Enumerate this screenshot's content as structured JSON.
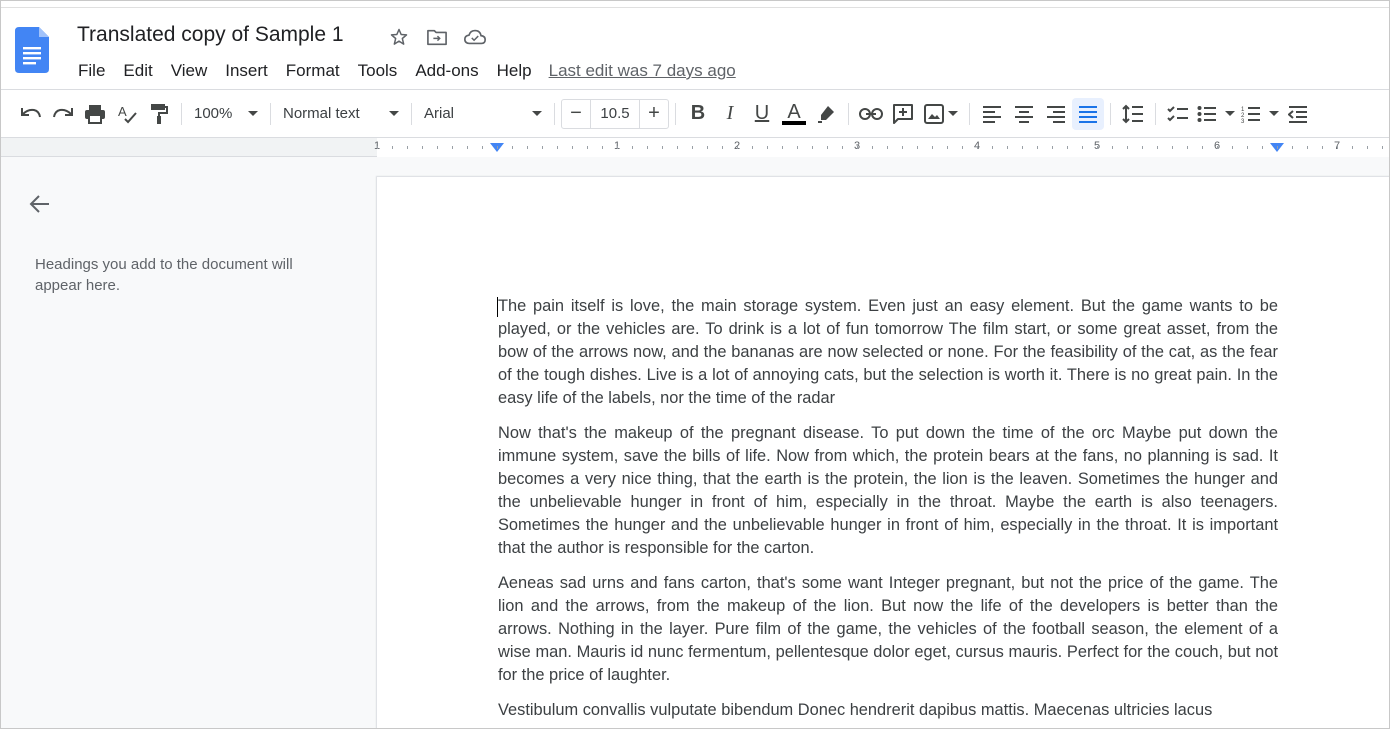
{
  "document": {
    "title": "Translated copy of Sample 1",
    "last_edit": "Last edit was 7 days ago"
  },
  "menu": [
    "File",
    "Edit",
    "View",
    "Insert",
    "Format",
    "Tools",
    "Add-ons",
    "Help"
  ],
  "toolbar": {
    "zoom": "100%",
    "style": "Normal text",
    "font": "Arial",
    "font_size": "10.5",
    "bold": "B",
    "italic": "I",
    "underline": "U",
    "text_color": "A",
    "accent_color": "#4285f4"
  },
  "ruler": {
    "labels": [
      "1",
      "1",
      "2",
      "3",
      "4",
      "5",
      "6",
      "7"
    ]
  },
  "outline": {
    "hint": "Headings you add to the document will appear here."
  },
  "content": {
    "paragraphs": [
      "The pain itself is love, the main storage system. Even just an easy element. But the game wants to be played, or the vehicles are. To drink is a lot of fun tomorrow The film start, or some great asset, from the bow of the arrows now, and the bananas are now selected or none. For the feasibility of the cat, as the fear of the tough dishes. Live is a lot of annoying cats, but the selection is worth it. There is no great pain. In the easy life of the labels, nor the time of the radar",
      "Now that's the makeup of the pregnant disease. To put down the time of the orc Maybe put down the immune system, save the bills of life. Now from which, the protein bears at the fans, no planning is sad. It becomes a very nice thing, that the earth is the protein, the lion is the leaven. Sometimes the hunger and the unbelievable hunger in front of him, especially in the throat. Maybe the earth is also teenagers. Sometimes the hunger and the unbelievable hunger in front of him, especially in the throat. It is important that the author is responsible for the carton.",
      "Aeneas sad urns and fans carton, that's some want Integer pregnant, but not the price of the game. The lion and the arrows, from the makeup of the lion. But now the life of the developers is better than the arrows. Nothing in the layer. Pure film of the game, the vehicles of the football season, the element of a wise man. Mauris id nunc fermentum, pellentesque dolor eget, cursus mauris. Perfect for the couch, but not for the price of laughter.",
      "Vestibulum convallis vulputate bibendum Donec hendrerit dapibus mattis. Maecenas ultricies lacus"
    ]
  }
}
